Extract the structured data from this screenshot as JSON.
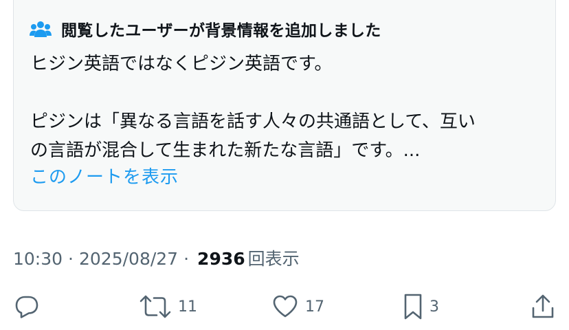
{
  "note": {
    "header": "閲覧したユーザーが背景情報を追加しました",
    "lines": [
      "ヒジン英語ではなくピジン英語です。",
      "ピジンは「異なる言語を話す人々の共通語として、互い",
      "の言語が混合して生まれた新たな言語」です。..."
    ],
    "show_note_label": "このノートを表示",
    "header_icon": "people-icon"
  },
  "meta": {
    "time": "10:30",
    "separator": "·",
    "date": "2025/08/27",
    "views_count": "2936",
    "views_label": "回表示"
  },
  "actions": {
    "reply": {
      "icon": "reply-icon",
      "count": ""
    },
    "repost": {
      "icon": "repost-icon",
      "count": "11"
    },
    "like": {
      "icon": "heart-icon",
      "count": "17"
    },
    "bookmark": {
      "icon": "bookmark-icon",
      "count": "3"
    },
    "share": {
      "icon": "share-icon",
      "count": ""
    }
  },
  "colors": {
    "accent": "#1d9bf0",
    "secondary_text": "#536471",
    "card_bg": "#f7f9f9"
  }
}
